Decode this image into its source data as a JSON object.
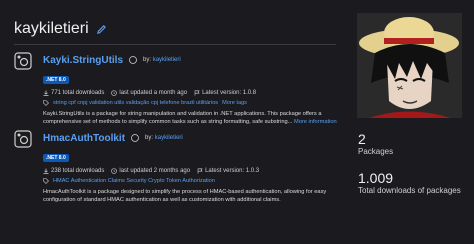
{
  "profile": {
    "username": "kaykiletieri",
    "total_packages": "2",
    "packages_label": "Packages",
    "total_downloads": "1.009",
    "downloads_label": "Total downloads of packages"
  },
  "packages": [
    {
      "title": "Kayki.StringUtils",
      "by_label": "by:",
      "author": "kaykiletieri",
      "framework": ".NET 8.0",
      "downloads": "771 total downloads",
      "last_updated": "last updated a month ago",
      "latest_version": "Latest version: 1.0.8",
      "tags": "string cpf cnpj validation utils validação cpj telefone brazil utilitários",
      "more_tags": "More tags",
      "description": "Kayki.StringUtils is a package for string manipulation and validation in .NET applications. This package offers a comprehensive set of methods to simplify common tasks such as string formatting, safe substring...",
      "more_info": "More information"
    },
    {
      "title": "HmacAuthToolkit",
      "by_label": "by:",
      "author": "kaykiletieri",
      "framework": ".NET 8.0",
      "downloads": "238 total downloads",
      "last_updated": "last updated 2 months ago",
      "latest_version": "Latest version: 1.0.3",
      "tags": "HMAC Authentication Claims Security Crypto Token Authorization",
      "description": "HmacAuthToolkit is a package designed to simplify the process of HMAC-based authentication, allowing for easy configuration of standard HMAC authentication as well as customization with additional claims."
    }
  ],
  "colors": {
    "background": "#1b1b1f",
    "link": "#5a9ff0",
    "badge": "#0b59b8"
  }
}
